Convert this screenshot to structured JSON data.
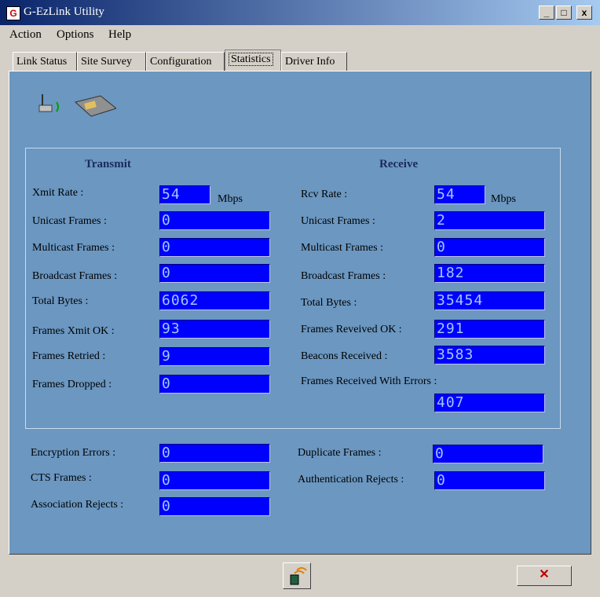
{
  "window": {
    "title": "G-EzLink Utility",
    "app_icon_letter": "G",
    "minimize": "_",
    "maximize": "□",
    "close": "x"
  },
  "menu": [
    "Action",
    "Options",
    "Help"
  ],
  "tabs": [
    "Link Status",
    "Site Survey",
    "Configuration",
    "Statistics",
    "Driver Info"
  ],
  "active_tab": "Statistics",
  "transmit": {
    "heading": "Transmit",
    "xmit_rate": {
      "label": "Xmit Rate :",
      "value": "54",
      "unit": "Mbps"
    },
    "unicast_frames": {
      "label": "Unicast Frames :",
      "value": "0"
    },
    "multicast_frames": {
      "label": "Multicast Frames :",
      "value": "0"
    },
    "broadcast_frames": {
      "label": "Broadcast Frames :",
      "value": "0"
    },
    "total_bytes": {
      "label": "Total Bytes :",
      "value": "6062"
    },
    "frames_xmit_ok": {
      "label": "Frames Xmit OK :",
      "value": "93"
    },
    "frames_retried": {
      "label": "Frames Retried :",
      "value": "9"
    },
    "frames_dropped": {
      "label": "Frames Dropped :",
      "value": "0"
    }
  },
  "receive": {
    "heading": "Receive",
    "rcv_rate": {
      "label": "Rcv Rate :",
      "value": "54",
      "unit": "Mbps"
    },
    "unicast_frames": {
      "label": "Unicast Frames :",
      "value": "2"
    },
    "multicast_frames": {
      "label": "Multicast Frames :",
      "value": "0"
    },
    "broadcast_frames": {
      "label": "Broadcast Frames :",
      "value": "182"
    },
    "total_bytes": {
      "label": "Total Bytes :",
      "value": "35454"
    },
    "frames_received_ok": {
      "label": "Frames Reveived OK :",
      "value": "291"
    },
    "beacons_received": {
      "label": "Beacons Received :",
      "value": "3583"
    },
    "frames_received_errors": {
      "label": "Frames Received With Errors :",
      "value": "407"
    }
  },
  "errors": {
    "encryption_errors": {
      "label": "Encryption Errors :",
      "value": "0"
    },
    "cts_frames": {
      "label": "CTS Frames :",
      "value": "0"
    },
    "association_rejects": {
      "label": "Association Rejects :",
      "value": "0"
    },
    "duplicate_frames": {
      "label": "Duplicate Frames :",
      "value": "0"
    },
    "authentication_rejects": {
      "label": "Authentication Rejects :",
      "value": "0"
    }
  },
  "bottom": {
    "cancel_glyph": "✕"
  },
  "colors": {
    "lcd_bg": "#0000ff",
    "lcd_text": "#a0c8ff",
    "panel": "#6b97c1",
    "close_x": "#c00000"
  }
}
